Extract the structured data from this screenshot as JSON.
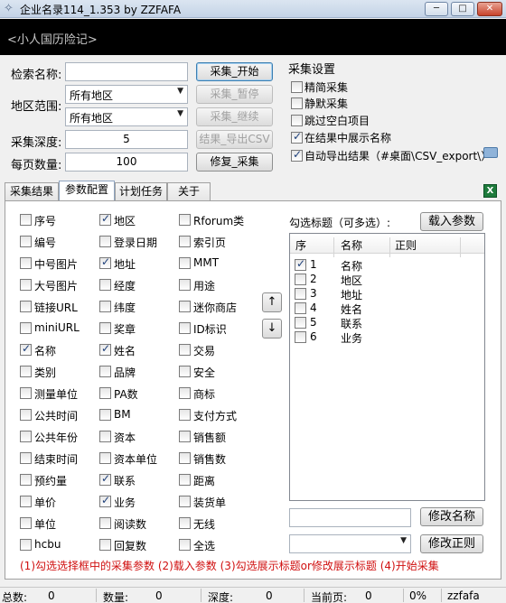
{
  "window": {
    "title": "企业名录114_1.353 by ZZFAFA",
    "app_icon": "star-icon",
    "minimize": "─",
    "maximize": "□",
    "close": "✕"
  },
  "banner": {
    "text": "<小人国历险记>"
  },
  "form": {
    "keyword_label": "检索名称:",
    "keyword_value": "",
    "region_label": "地区范围:",
    "region1": "所有地区",
    "region2": "所有地区",
    "depth_label": "采集深度:",
    "depth_value": "5",
    "perpage_label": "每页数量:",
    "perpage_value": "100"
  },
  "buttons": {
    "start": "采集_开始",
    "pause": "采集_暂停",
    "resume": "采集_继续",
    "export": "结果_导出CSV",
    "repair": "修复_采集"
  },
  "settings": {
    "title": "采集设置",
    "items": [
      {
        "label": "精简采集",
        "checked": false
      },
      {
        "label": "静默采集",
        "checked": false
      },
      {
        "label": "跳过空白项目",
        "checked": false
      },
      {
        "label": "在结果中展示名称",
        "checked": true
      },
      {
        "label": "自动导出结果（#桌面\\CSV_export\\）",
        "checked": true
      }
    ],
    "folder_icon": "folder-icon"
  },
  "tabs": [
    "采集结果",
    "参数配置",
    "计划任务",
    "关于"
  ],
  "active_tab": 1,
  "excel_icon": "excel-icon",
  "fields": [
    {
      "label": "序号",
      "checked": false
    },
    {
      "label": "编号",
      "checked": false
    },
    {
      "label": "中号图片",
      "checked": false
    },
    {
      "label": "大号图片",
      "checked": false
    },
    {
      "label": "链接URL",
      "checked": false
    },
    {
      "label": "miniURL",
      "checked": false
    },
    {
      "label": "名称",
      "checked": true
    },
    {
      "label": "类别",
      "checked": false
    },
    {
      "label": "测量单位",
      "checked": false
    },
    {
      "label": "公共时间",
      "checked": false
    },
    {
      "label": "公共年份",
      "checked": false
    },
    {
      "label": "结束时间",
      "checked": false
    },
    {
      "label": "预约量",
      "checked": false
    },
    {
      "label": "单价",
      "checked": false
    },
    {
      "label": "单位",
      "checked": false
    },
    {
      "label": "hcbu",
      "checked": false
    },
    {
      "label": "地区",
      "checked": true
    },
    {
      "label": "登录日期",
      "checked": false
    },
    {
      "label": "地址",
      "checked": true
    },
    {
      "label": "经度",
      "checked": false
    },
    {
      "label": "纬度",
      "checked": false
    },
    {
      "label": "奖章",
      "checked": false
    },
    {
      "label": "姓名",
      "checked": true
    },
    {
      "label": "品牌",
      "checked": false
    },
    {
      "label": "PA数",
      "checked": false
    },
    {
      "label": "BM",
      "checked": false
    },
    {
      "label": "资本",
      "checked": false
    },
    {
      "label": "资本单位",
      "checked": false
    },
    {
      "label": "联系",
      "checked": true
    },
    {
      "label": "业务",
      "checked": true
    },
    {
      "label": "阅读数",
      "checked": false
    },
    {
      "label": "回复数",
      "checked": false
    },
    {
      "label": "Rforum类",
      "checked": false
    },
    {
      "label": "索引页",
      "checked": false
    },
    {
      "label": "MMT",
      "checked": false
    },
    {
      "label": "用途",
      "checked": false
    },
    {
      "label": "迷你商店",
      "checked": false
    },
    {
      "label": "ID标识",
      "checked": false
    },
    {
      "label": "交易",
      "checked": false
    },
    {
      "label": "安全",
      "checked": false
    },
    {
      "label": "商标",
      "checked": false
    },
    {
      "label": "支付方式",
      "checked": false
    },
    {
      "label": "销售额",
      "checked": false
    },
    {
      "label": "销售数",
      "checked": false
    },
    {
      "label": "距离",
      "checked": false
    },
    {
      "label": "装货单",
      "checked": false
    },
    {
      "label": "无线",
      "checked": false
    },
    {
      "label": "全选",
      "checked": false
    }
  ],
  "move_up": "↑",
  "move_down": "↓",
  "titles_panel": {
    "label": "勾选标题（可多选）:",
    "load_button": "载入参数",
    "columns": [
      "序",
      "名称",
      "正则"
    ],
    "rows": [
      {
        "num": "1",
        "name": "名称",
        "regex": "",
        "checked": true
      },
      {
        "num": "2",
        "name": "地区",
        "regex": "",
        "checked": false
      },
      {
        "num": "3",
        "name": "地址",
        "regex": "",
        "checked": false
      },
      {
        "num": "4",
        "name": "姓名",
        "regex": "",
        "checked": false
      },
      {
        "num": "5",
        "name": "联系",
        "regex": "",
        "checked": false
      },
      {
        "num": "6",
        "name": "业务",
        "regex": "",
        "checked": false
      }
    ],
    "name_value": "",
    "rename_button": "修改名称",
    "regex_value": "",
    "edit_regex_button": "修改正则"
  },
  "help_text": "(1)勾选选择框中的采集参数  (2)载入参数  (3)勾选展示标题or修改展示标题  (4)开始采集",
  "status": {
    "total_label": "总数:",
    "total_value": "0",
    "count_label": "数量:",
    "count_value": "0",
    "depth_label": "深度:",
    "depth_value": "0",
    "page_label": "当前页:",
    "page_value": "0",
    "percent": "0%",
    "author": "zzfafa"
  }
}
